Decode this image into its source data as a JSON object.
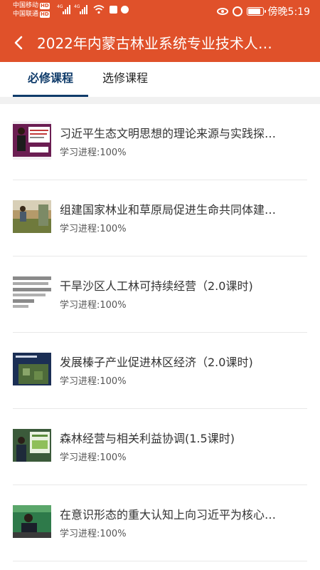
{
  "status_bar": {
    "carrier1": "中国移动",
    "carrier2": "中国联通",
    "hd": "HD",
    "net": "4G",
    "time": "傍晚5:19"
  },
  "header": {
    "title": "2022年内蒙古林业系统专业技术人…"
  },
  "tabs": [
    {
      "label": "必修课程",
      "active": true
    },
    {
      "label": "选修课程",
      "active": false
    }
  ],
  "courses": [
    {
      "title": "习近平生态文明思想的理论来源与实践探…",
      "progress": "学习进程:100%",
      "thumb": "speaker-slide-thumbnail"
    },
    {
      "title": "组建国家林业和草原局促进生命共同体建…",
      "progress": "学习进程:100%",
      "thumb": "grassland-thumbnail"
    },
    {
      "title": "干旱沙区人工林可持续经营（2.0课时)",
      "progress": "学习进程:100%",
      "thumb": "text-slide-thumbnail"
    },
    {
      "title": "发展榛子产业促进林区经济（2.0课时)",
      "progress": "学习进程:100%",
      "thumb": "forest-slide-thumbnail"
    },
    {
      "title": "森林经营与相关利益协调(1.5课时)",
      "progress": "学习进程:100%",
      "thumb": "lecturer-green-thumbnail"
    },
    {
      "title": "在意识形态的重大认知上向习近平为核心…",
      "progress": "学习进程:100%",
      "thumb": "lecturer-desk-thumbnail"
    }
  ],
  "colors": {
    "header": "#e0512a",
    "tab_active": "#0f3b6a"
  }
}
